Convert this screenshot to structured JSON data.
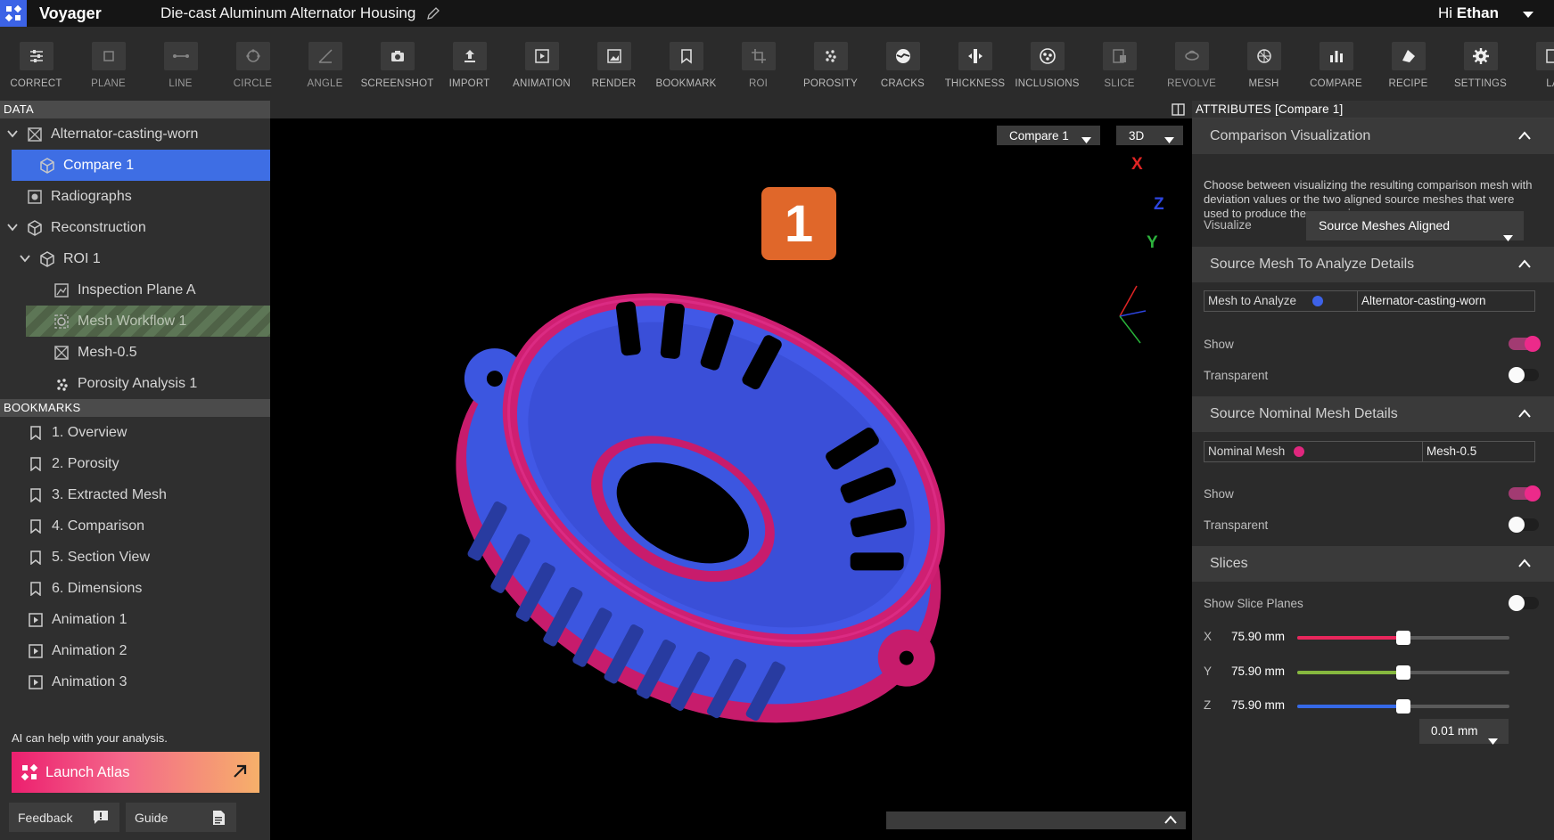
{
  "app": {
    "name": "Voyager",
    "document_title": "Die-cast Aluminum Alternator Housing",
    "greeting_prefix": "Hi",
    "user_name": "Ethan"
  },
  "toolbar": {
    "tools": [
      {
        "label": "CORRECT",
        "icon": "sliders-icon"
      },
      {
        "label": "PLANE",
        "icon": "plane-icon"
      },
      {
        "label": "LINE",
        "icon": "line-icon"
      },
      {
        "label": "CIRCLE",
        "icon": "circle-icon"
      },
      {
        "label": "ANGLE",
        "icon": "angle-icon"
      },
      {
        "label": "SCREENSHOT",
        "icon": "camera-icon"
      },
      {
        "label": "IMPORT",
        "icon": "upload-icon"
      },
      {
        "label": "ANIMATION",
        "icon": "play-icon"
      },
      {
        "label": "RENDER",
        "icon": "image-icon"
      },
      {
        "label": "BOOKMARK",
        "icon": "bookmark-icon"
      },
      {
        "label": "ROI",
        "icon": "crop-icon"
      },
      {
        "label": "POROSITY",
        "icon": "porosity-icon"
      },
      {
        "label": "CRACKS",
        "icon": "cracks-icon"
      },
      {
        "label": "THICKNESS",
        "icon": "thickness-icon"
      },
      {
        "label": "INCLUSIONS",
        "icon": "inclusions-icon"
      },
      {
        "label": "SLICE",
        "icon": "slice-icon"
      },
      {
        "label": "REVOLVE",
        "icon": "revolve-icon"
      },
      {
        "label": "MESH",
        "icon": "mesh-icon"
      },
      {
        "label": "COMPARE",
        "icon": "compare-icon"
      },
      {
        "label": "RECIPE",
        "icon": "recipe-icon"
      },
      {
        "label": "SETTINGS",
        "icon": "gear-icon"
      },
      {
        "label": "LA",
        "icon": "layout-icon"
      }
    ]
  },
  "data_panel": {
    "header": "DATA",
    "items": [
      {
        "label": "Alternator-casting-worn",
        "icon": "scan-icon"
      },
      {
        "label": "Compare 1",
        "icon": "cube-icon"
      },
      {
        "label": "Radiographs",
        "icon": "radiograph-icon"
      },
      {
        "label": "Reconstruction",
        "icon": "cube-icon"
      },
      {
        "label": "ROI 1",
        "icon": "cube-icon"
      },
      {
        "label": "Inspection Plane A",
        "icon": "plane-image-icon"
      },
      {
        "label": "Mesh Workflow 1",
        "icon": "workflow-icon"
      },
      {
        "label": "Mesh-0.5",
        "icon": "scan-icon"
      },
      {
        "label": "Porosity Analysis 1",
        "icon": "porosity-icon"
      }
    ]
  },
  "bookmarks_panel": {
    "header": "BOOKMARKS",
    "items": [
      {
        "label": "1. Overview",
        "icon": "bookmark-icon"
      },
      {
        "label": "2. Porosity",
        "icon": "bookmark-icon"
      },
      {
        "label": "3. Extracted Mesh",
        "icon": "bookmark-icon"
      },
      {
        "label": "4. Comparison",
        "icon": "bookmark-icon"
      },
      {
        "label": "5. Section View",
        "icon": "bookmark-icon"
      },
      {
        "label": "6. Dimensions",
        "icon": "bookmark-icon"
      },
      {
        "label": "Animation 1",
        "icon": "animation-icon"
      },
      {
        "label": "Animation 2",
        "icon": "animation-icon"
      },
      {
        "label": "Animation 3",
        "icon": "animation-icon"
      }
    ]
  },
  "ai": {
    "prompt": "AI can help with your analysis.",
    "launch_label": "Launch Atlas"
  },
  "footer": {
    "feedback_label": "Feedback",
    "guide_label": "Guide"
  },
  "viewport": {
    "compare_select": "Compare 1",
    "view_mode": "3D",
    "axes": {
      "x": "X",
      "y": "Y",
      "z": "Z"
    },
    "step_badge": "1"
  },
  "attributes": {
    "header": "ATTRIBUTES [Compare 1]",
    "comparison": {
      "title": "Comparison Visualization",
      "description": "Choose between visualizing the resulting comparison mesh with deviation values or the two aligned source meshes that were used to produce the comparison.",
      "visualize_label": "Visualize",
      "visualize_value": "Source Meshes Aligned"
    },
    "analyze": {
      "title": "Source Mesh To Analyze Details",
      "field_label": "Mesh to Analyze",
      "field_value": "Alternator-casting-worn",
      "dot_color": "#3d62e8",
      "show_label": "Show",
      "transparent_label": "Transparent"
    },
    "nominal": {
      "title": "Source Nominal Mesh Details",
      "field_label": "Nominal Mesh",
      "field_value": "Mesh-0.5",
      "dot_color": "#e0277e",
      "show_label": "Show",
      "transparent_label": "Transparent"
    },
    "slices": {
      "title": "Slices",
      "show_planes_label": "Show Slice Planes",
      "x": {
        "axis": "X",
        "value": "75.90 mm",
        "level": 0.5,
        "color": "#e8265c"
      },
      "y": {
        "axis": "Y",
        "value": "75.90 mm",
        "level": 0.5,
        "color": "#86b83f"
      },
      "z": {
        "axis": "Z",
        "value": "75.90 mm",
        "level": 0.5,
        "color": "#3569e8"
      },
      "step": "0.01 mm"
    }
  },
  "colors": {
    "accent": "#3e6ee4",
    "analyze_mesh": "#3d5ce6",
    "nominal_mesh": "#d0206f",
    "badge": "#e0672a"
  }
}
